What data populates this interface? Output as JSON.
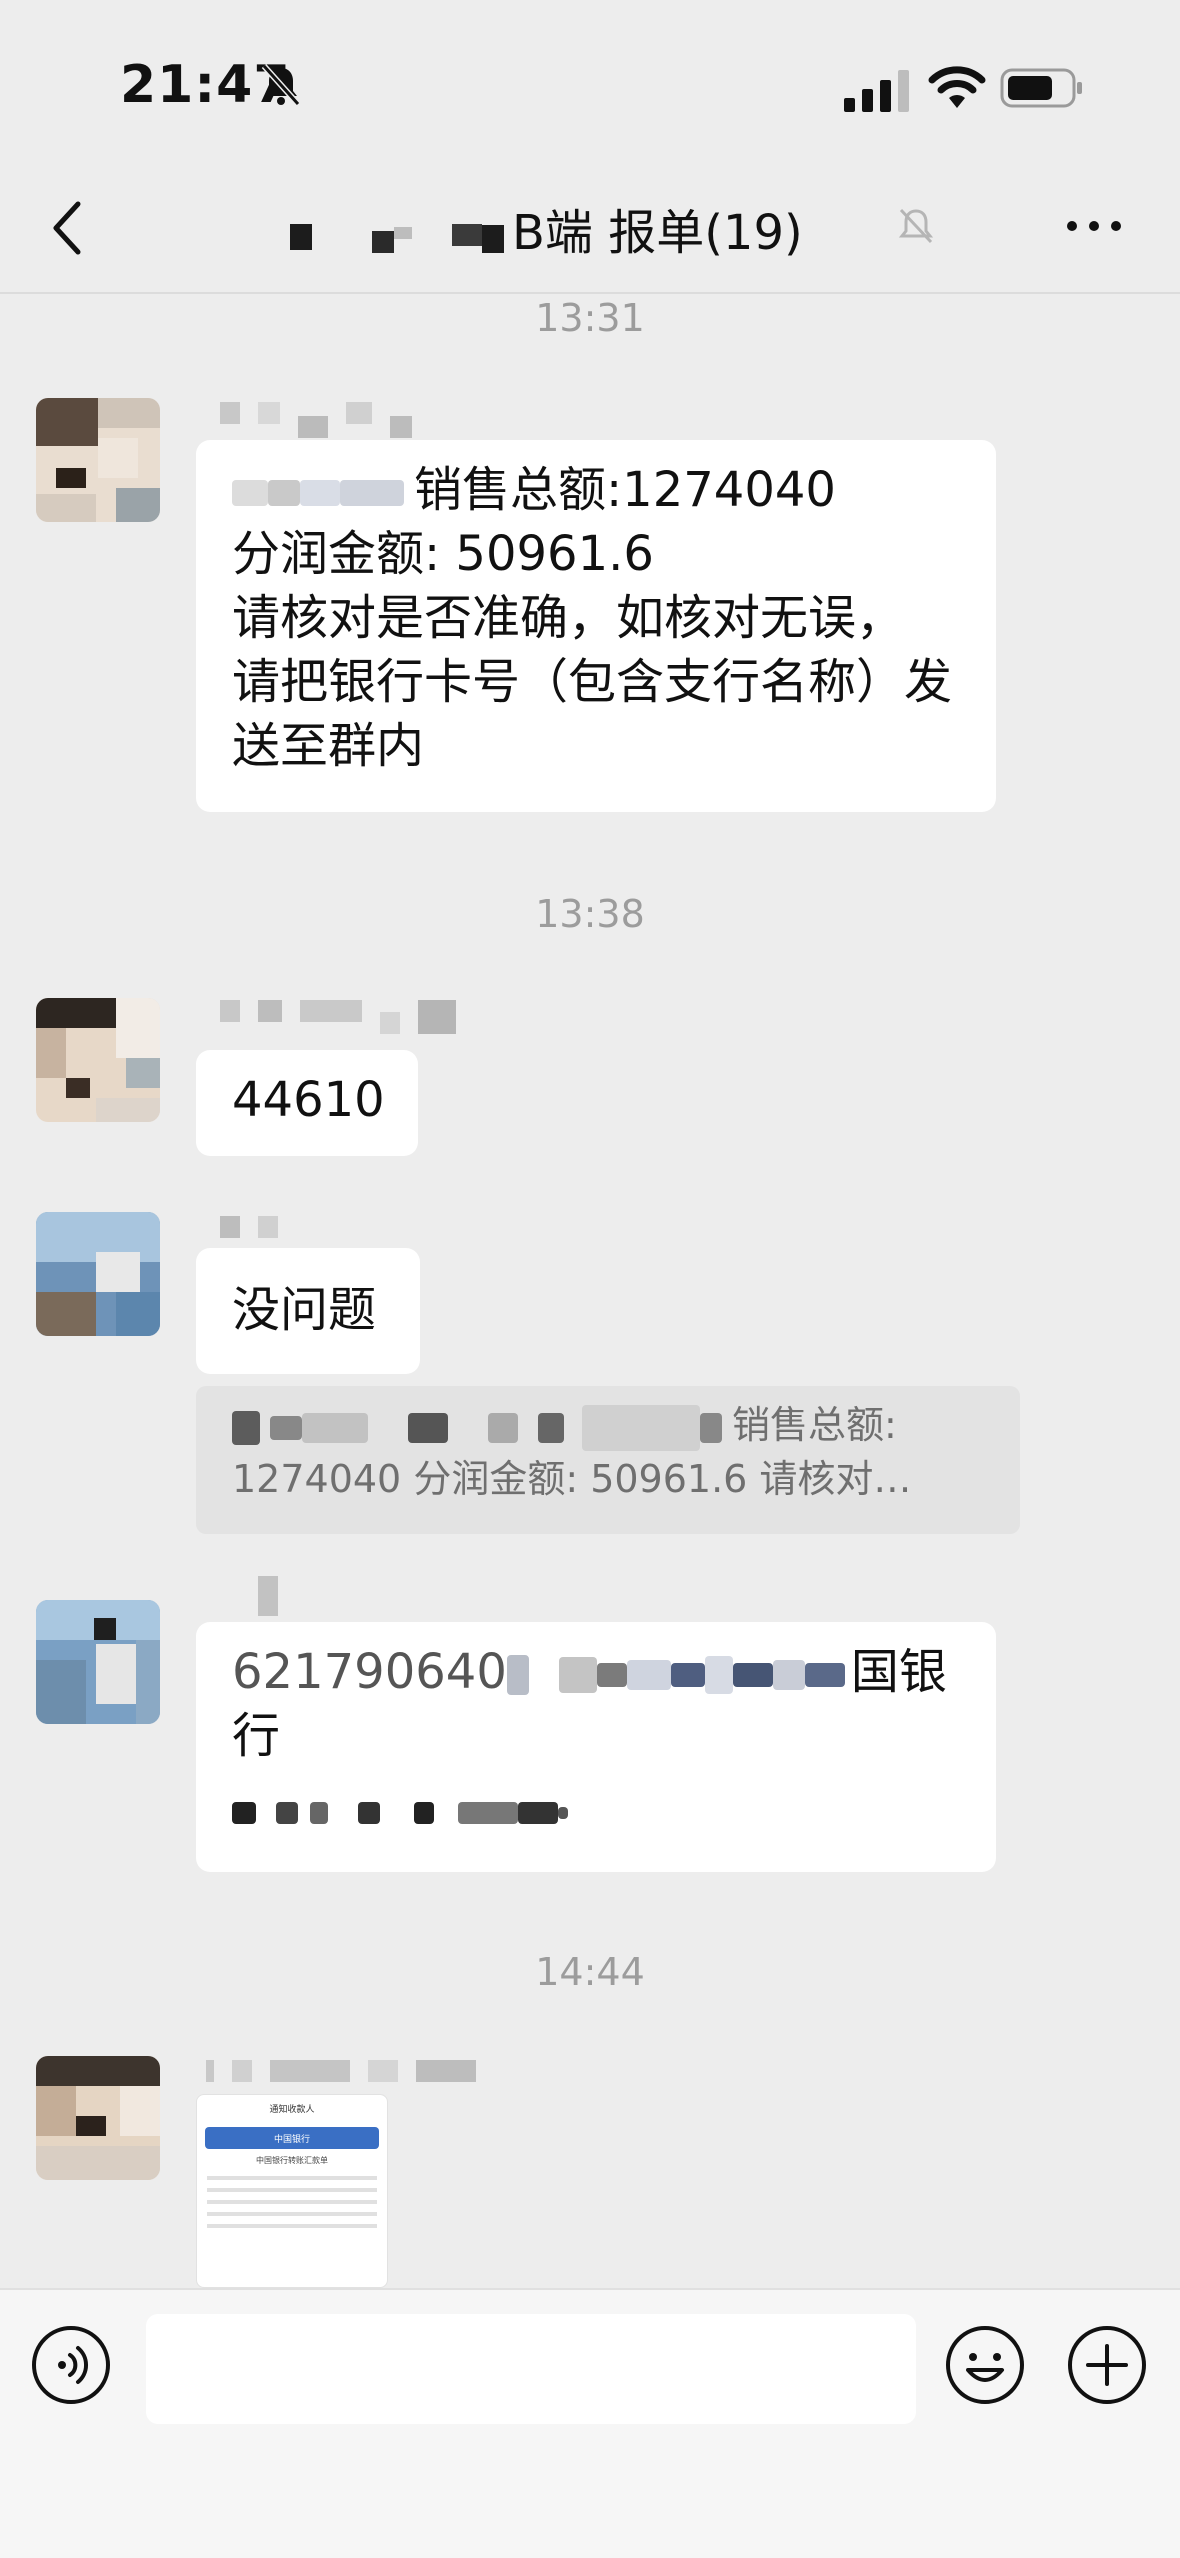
{
  "status_bar": {
    "time": "21:47"
  },
  "nav": {
    "title": "B端 报单(19)"
  },
  "messages": {
    "t1": "13:31",
    "msg1_lines": [
      "销售总额:1274040",
      "分润金额:  50961.6",
      "请核对是否准确，如核对无误，",
      "请把银行卡号（包含支行名称）发",
      "送至群内"
    ],
    "msg1_prefix_hidden": "",
    "t2": "13:38",
    "msg2": "44610",
    "msg3": "没问题",
    "quote_line1": "销售总额:",
    "quote_line2": "1274040 分润金额:  50961.6 请核对…",
    "msg4_line1_start": "621790640",
    "msg4_line1_end": "国银",
    "msg4_line2": "行",
    "t3": "14:44",
    "image_card": {
      "header_title": "通知收款人",
      "bank_banner": "中国银行",
      "subtitle": "中国银行转账汇款单"
    }
  },
  "icons": {
    "mute": "bell-slash-icon",
    "back": "chevron-left-icon",
    "more": "more-horizontal-icon",
    "voice": "voice-input-icon",
    "emoji": "emoji-icon",
    "plus": "plus-circle-icon"
  }
}
